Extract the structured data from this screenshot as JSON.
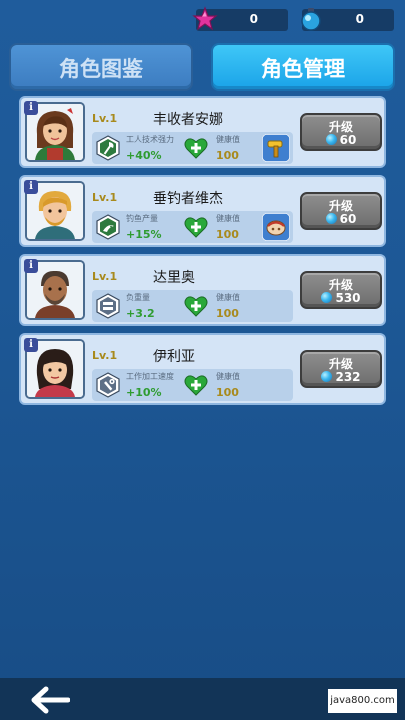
{
  "currencies": {
    "star": {
      "icon": "pink-star-icon",
      "value": "0"
    },
    "gem": {
      "icon": "blue-gem-bottle-icon",
      "value": "0"
    }
  },
  "tabs": [
    {
      "label": "角色图鉴",
      "active": false
    },
    {
      "label": "角色管理",
      "active": true
    }
  ],
  "characters": [
    {
      "name": "丰收者安娜",
      "level": "Lv.1",
      "skill_label": "工人技术强力",
      "skill_value": "+40%",
      "skill_icon": "axe-icon",
      "health_label": "健康值",
      "health_value": "100",
      "item_icon": "golden-hammer-icon",
      "upgrade_label": "升级",
      "upgrade_cost": "60"
    },
    {
      "name": "垂钓者维杰",
      "level": "Lv.1",
      "skill_label": "钓鱼产量",
      "skill_value": "+15%",
      "skill_icon": "fishing-icon",
      "health_label": "健康值",
      "health_value": "100",
      "item_icon": "fish-bait-icon",
      "upgrade_label": "升级",
      "upgrade_cost": "60"
    },
    {
      "name": "达里奥",
      "level": "Lv.1",
      "skill_label": "负重量",
      "skill_value": "+3.2",
      "skill_icon": "weight-icon",
      "health_label": "健康值",
      "health_value": "100",
      "item_icon": "",
      "upgrade_label": "升级",
      "upgrade_cost": "530"
    },
    {
      "name": "伊利亚",
      "level": "Lv.1",
      "skill_label": "工作加工速度",
      "skill_value": "+10%",
      "skill_icon": "wrench-icon",
      "health_label": "健康值",
      "health_value": "100",
      "item_icon": "",
      "upgrade_label": "升级",
      "upgrade_cost": "232"
    }
  ],
  "footer": {
    "back_icon": "back-arrow-icon",
    "watermark": "java800.com"
  },
  "colors": {
    "background": "#1d5896",
    "card": "#d4e4f6",
    "tab_active": "#1aa3e8",
    "tab_inactive": "#3c7cc0",
    "level_gold": "#a88a1d",
    "skill_green": "#2f9c31"
  }
}
